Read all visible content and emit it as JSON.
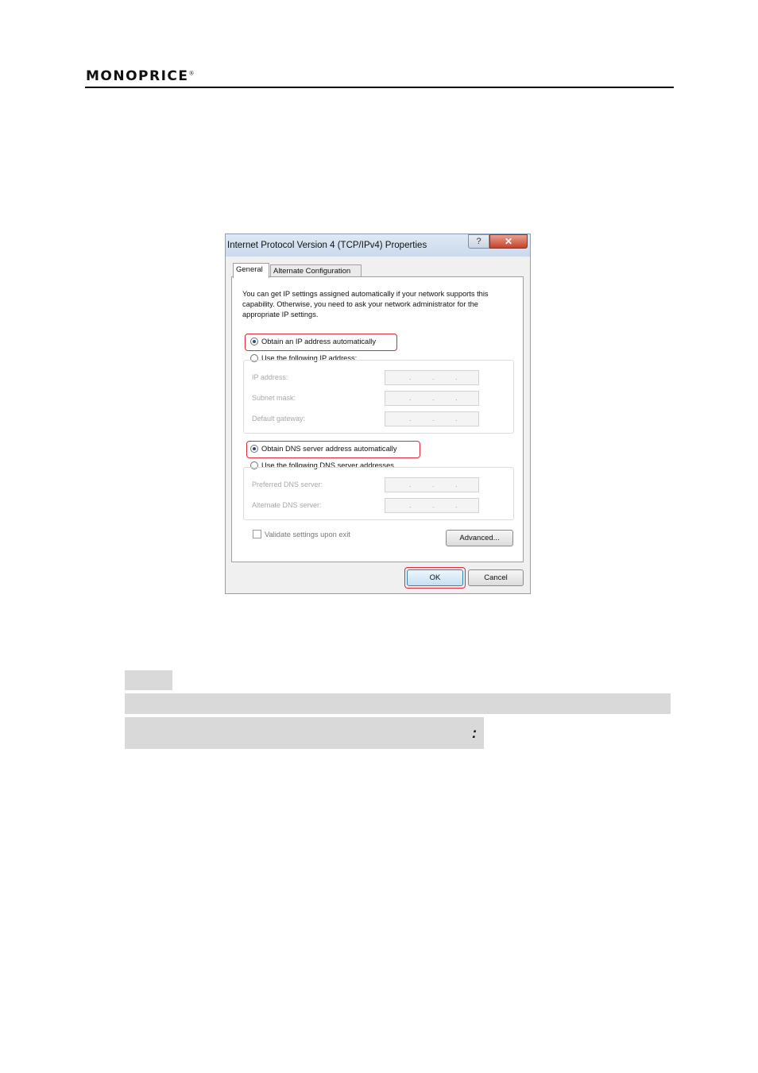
{
  "header": {
    "logo_text": "MONOPRICE",
    "logo_mark": "®"
  },
  "dialog": {
    "title": "Internet Protocol Version 4 (TCP/IPv4) Properties",
    "help_label": "?",
    "close_label": "✕",
    "tabs": [
      {
        "label": "General",
        "active": true
      },
      {
        "label": "Alternate Configuration",
        "active": false
      }
    ],
    "intro_text": "You can get IP settings assigned automatically if your network supports this capability. Otherwise, you need to ask your network administrator for the appropriate IP settings.",
    "ip_section": {
      "auto_option": "Obtain an IP address automatically",
      "manual_option": "Use the following IP address:",
      "selected": "auto",
      "fields": [
        {
          "label": "IP address:",
          "value": ".   .   ."
        },
        {
          "label": "Subnet mask:",
          "value": ".   .   ."
        },
        {
          "label": "Default gateway:",
          "value": ".   .   ."
        }
      ]
    },
    "dns_section": {
      "auto_option": "Obtain DNS server address automatically",
      "manual_option": "Use the following DNS server addresses",
      "selected": "auto",
      "fields": [
        {
          "label": "Preferred DNS server:",
          "value": ".   .   ."
        },
        {
          "label": "Alternate DNS server:",
          "value": ".   .   ."
        }
      ]
    },
    "validate_label": "Validate settings upon exit",
    "validate_checked": false,
    "advanced_label": "Advanced...",
    "ok_label": "OK",
    "cancel_label": "Cancel",
    "highlight_color": "#e0283a"
  },
  "footer_marks": {
    "colon": ":"
  }
}
